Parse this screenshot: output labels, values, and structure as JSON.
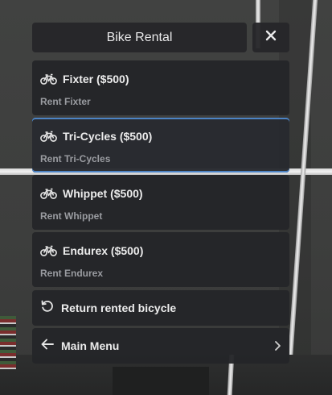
{
  "header": {
    "title": "Bike Rental",
    "close_icon": "close-icon"
  },
  "rentals": [
    {
      "label": "Fixter ($500)",
      "description": "Rent Fixter",
      "icon": "bicycle-icon"
    },
    {
      "label": "Tri-Cycles ($500)",
      "description": "Rent Tri-Cycles",
      "icon": "bicycle-icon",
      "selected": true
    },
    {
      "label": "Whippet ($500)",
      "description": "Rent Whippet",
      "icon": "bicycle-icon"
    },
    {
      "label": "Endurex ($500)",
      "description": "Rent Endurex",
      "icon": "bicycle-icon"
    }
  ],
  "return_item": {
    "label": "Return rented bicycle",
    "icon": "rotate-left-icon"
  },
  "main_menu": {
    "label": "Main Menu",
    "icon": "arrow-left-icon",
    "chevron": "chevron-right-icon"
  },
  "colors": {
    "selection_accent": "#4c83c4",
    "panel": "#26272a",
    "text": "#ececec",
    "subtext": "#9a9ca1"
  }
}
